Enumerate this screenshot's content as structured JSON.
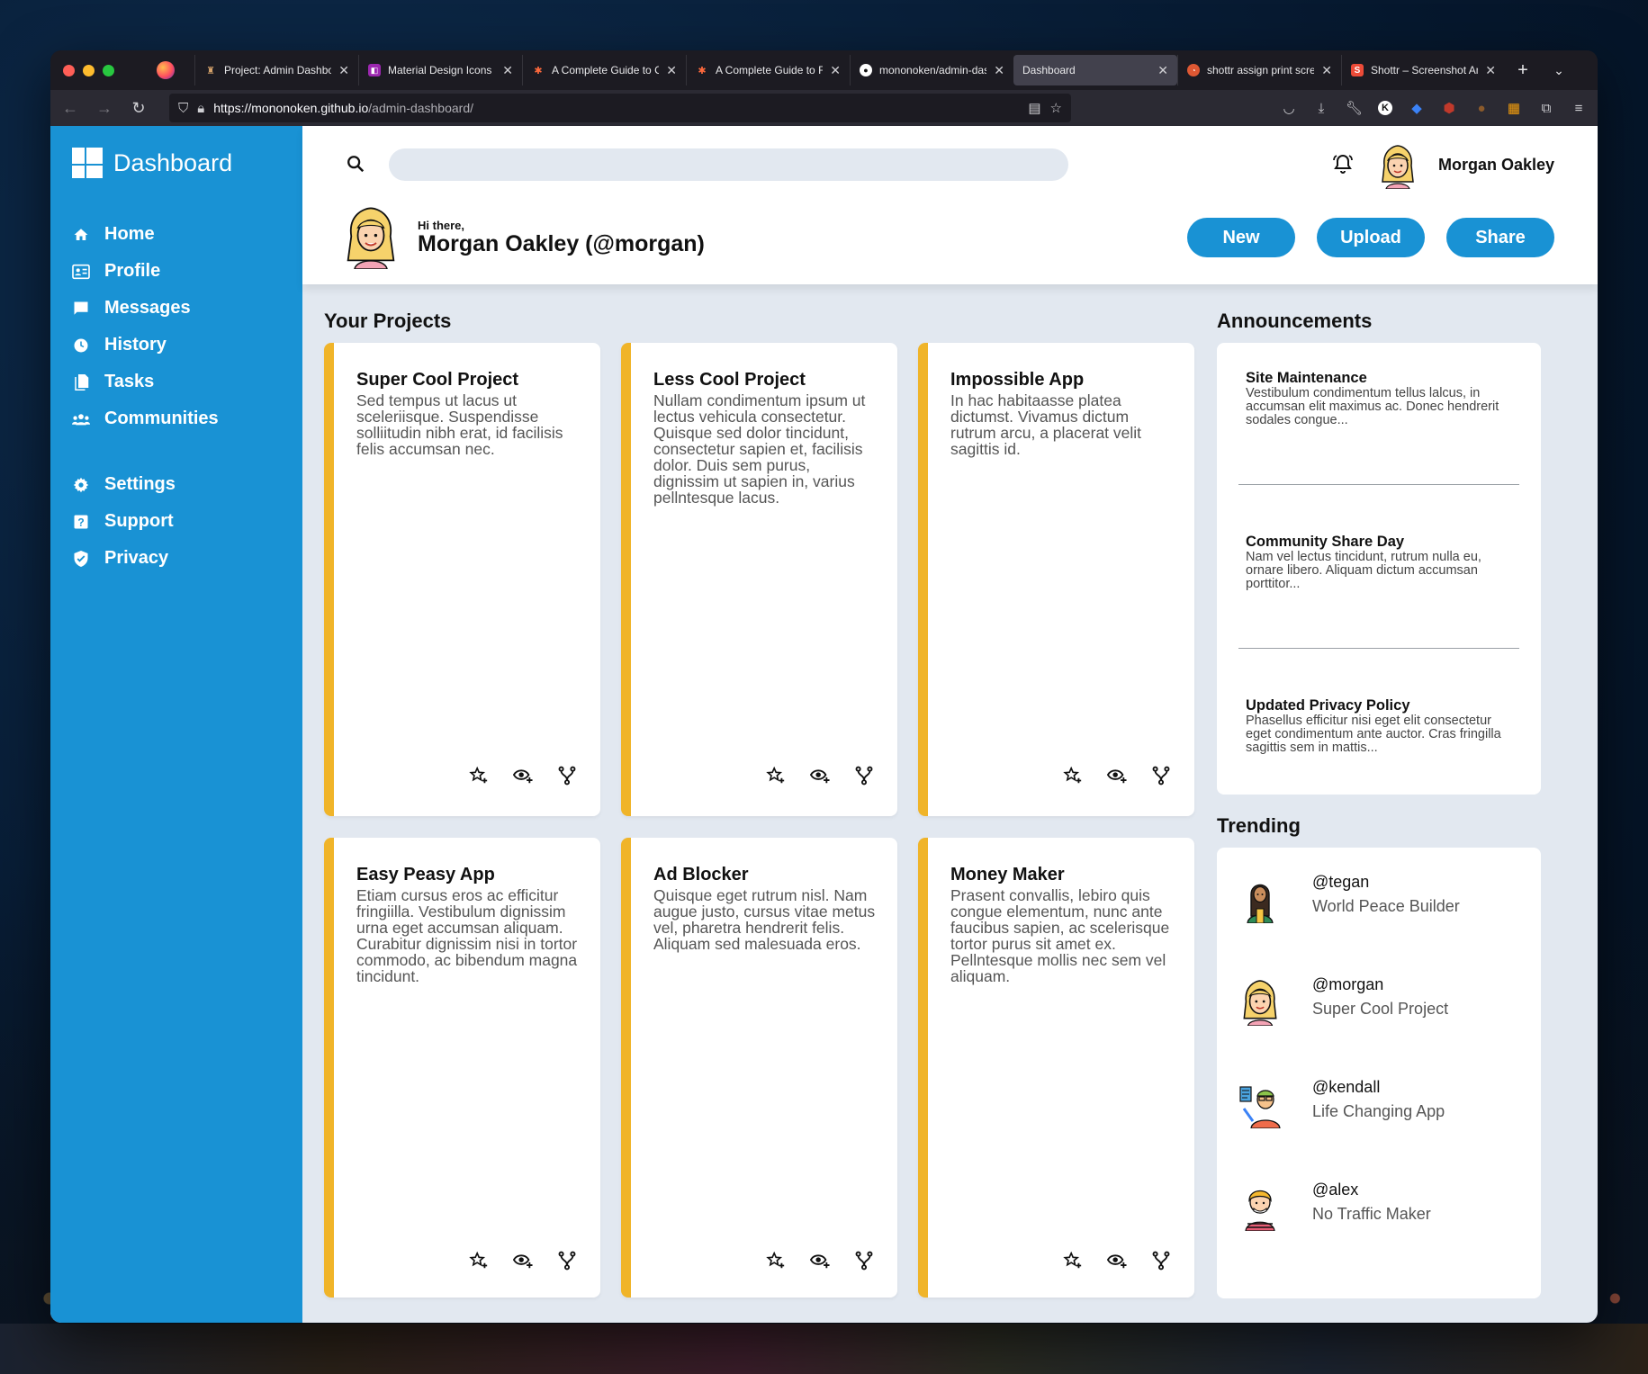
{
  "browser": {
    "tabs": [
      {
        "title": "Project: Admin Dashboard",
        "icon": "odin-icon",
        "active": false
      },
      {
        "title": "Material Design Icons -",
        "icon": "mdi-icon",
        "active": false
      },
      {
        "title": "A Complete Guide to CSS",
        "icon": "css-tricks-icon",
        "active": false
      },
      {
        "title": "A Complete Guide to Flex",
        "icon": "css-tricks-icon",
        "active": false
      },
      {
        "title": "mononoken/admin-dash",
        "icon": "github-icon",
        "active": false
      },
      {
        "title": "Dashboard",
        "icon": "",
        "active": true
      },
      {
        "title": "shottr assign print scre",
        "icon": "duckduckgo-icon",
        "active": false
      },
      {
        "title": "Shottr – Screenshot Ann",
        "icon": "shottr-icon",
        "active": false
      }
    ],
    "url_host": "https://mononoken.github.io",
    "url_path": "/admin-dashboard/"
  },
  "sidebar": {
    "title": "Dashboard",
    "items": [
      {
        "label": "Home",
        "icon": "home-icon"
      },
      {
        "label": "Profile",
        "icon": "profile-card-icon"
      },
      {
        "label": "Messages",
        "icon": "message-icon"
      },
      {
        "label": "History",
        "icon": "clock-icon"
      },
      {
        "label": "Tasks",
        "icon": "file-icon"
      },
      {
        "label": "Communities",
        "icon": "people-icon"
      }
    ],
    "items2": [
      {
        "label": "Settings",
        "icon": "gear-icon"
      },
      {
        "label": "Support",
        "icon": "help-icon"
      },
      {
        "label": "Privacy",
        "icon": "shield-icon"
      }
    ]
  },
  "header": {
    "search_placeholder": "",
    "username": "Morgan Oakley",
    "greeting": "Hi there,",
    "fullname": "Morgan Oakley (@morgan)",
    "buttons": {
      "new": "New",
      "upload": "Upload",
      "share": "Share"
    }
  },
  "projects": {
    "title": "Your Projects",
    "items": [
      {
        "title": "Super Cool Project",
        "desc": "Sed tempus ut lacus ut sceleriisque. Suspendisse solliitudin nibh erat, id facilisis felis accumsan nec."
      },
      {
        "title": "Less Cool Project",
        "desc": "Nullam condimentum ipsum ut lectus vehicula consectetur. Quisque sed dolor tincidunt, consectetur sapien et, facilisis dolor. Duis sem purus, dignissim ut sapien in, varius pellntesque lacus."
      },
      {
        "title": "Impossible App",
        "desc": "In hac habitaasse platea dictumst. Vivamus dictum rutrum arcu, a placerat velit sagittis id."
      },
      {
        "title": "Easy Peasy App",
        "desc": "Etiam cursus eros ac efficitur fringiilla. Vestibulum dignissim urna eget accumsan aliquam. Curabitur dignissim nisi in tortor commodo, ac bibendum magna tincidunt."
      },
      {
        "title": "Ad Blocker",
        "desc": "Quisque eget rutrum nisl. Nam augue justo, cursus vitae metus vel, pharetra hendrerit felis. Aliquam sed malesuada eros."
      },
      {
        "title": "Money Maker",
        "desc": "Prasent convallis, lebiro quis congue elementum, nunc ante faucibus sapien, ac scelerisque tortor purus sit amet ex. Pellntesque mollis nec sem vel aliquam."
      }
    ]
  },
  "announcements": {
    "title": "Announcements",
    "items": [
      {
        "title": "Site Maintenance",
        "desc": "Vestibulum condimentum tellus lalcus, in accumsan elit maximus ac. Donec hendrerit sodales congue..."
      },
      {
        "title": "Community Share Day",
        "desc": "Nam vel lectus tincidunt, rutrum nulla eu, ornare libero. Aliquam dictum accumsan porttitor..."
      },
      {
        "title": "Updated Privacy Policy",
        "desc": "Phasellus efficitur nisi eget elit consectetur eget condimentum ante auctor. Cras fringilla sagittis sem in mattis..."
      }
    ]
  },
  "trending": {
    "title": "Trending",
    "items": [
      {
        "handle": "@tegan",
        "project": "World Peace Builder"
      },
      {
        "handle": "@morgan",
        "project": "Super Cool Project"
      },
      {
        "handle": "@kendall",
        "project": "Life Changing App"
      },
      {
        "handle": "@alex",
        "project": "No Traffic Maker"
      }
    ]
  },
  "colors": {
    "accent": "#1992d4",
    "card_border": "#f0b429",
    "background": "#e2e8f0"
  }
}
